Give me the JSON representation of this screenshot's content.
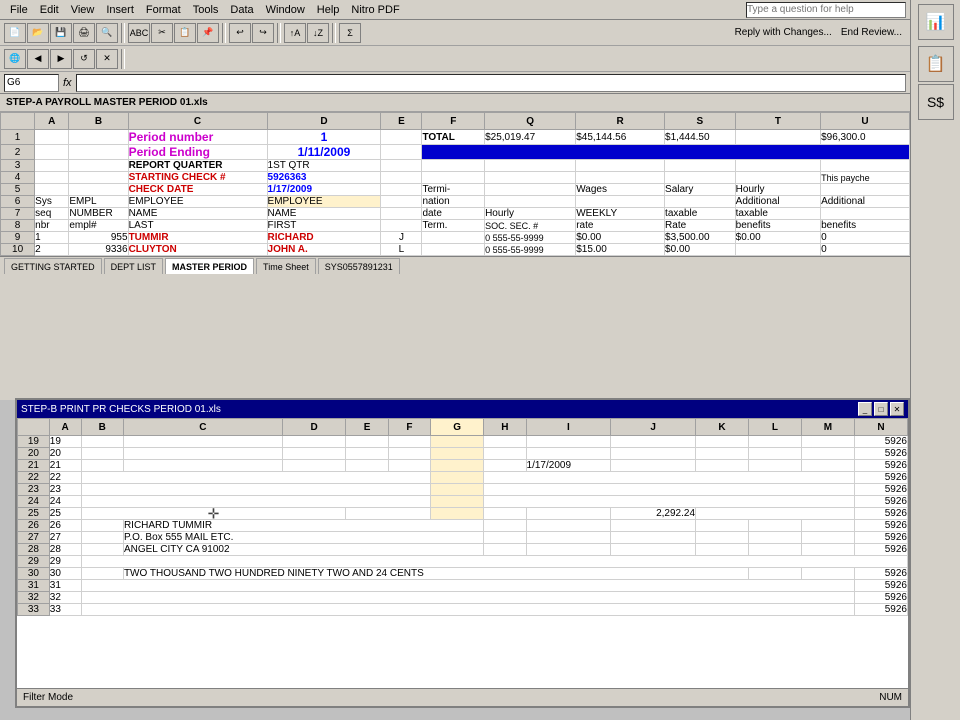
{
  "app": {
    "title": "STEP-A PAYROLL MASTER PERIOD 01.xls",
    "bottom_title": "STEP-B PRINT PR CHECKS PERIOD 01.xls",
    "question_placeholder": "Type a question for help"
  },
  "menu": {
    "items": [
      "File",
      "Edit",
      "View",
      "Insert",
      "Format",
      "Tools",
      "Data",
      "Window",
      "Help",
      "Nitro PDF"
    ]
  },
  "formula_bar": {
    "name_box": "G6",
    "formula": ""
  },
  "top_sheet": {
    "col_headers": [
      "",
      "A",
      "B",
      "C",
      "D",
      "E",
      "F",
      "Q",
      "R",
      "S",
      "T",
      "U"
    ],
    "rows": [
      {
        "num": "1",
        "a": "",
        "b": "",
        "c": "Period number",
        "d": "1",
        "e": "",
        "f": "TOTAL",
        "q": "$25,019.47",
        "r": "$45,144.56",
        "s": "$1,444.50",
        "t": "",
        "u": "$96,300.0"
      },
      {
        "num": "2",
        "a": "",
        "b": "",
        "c": "Period Ending",
        "d": "1/11/2009",
        "e": "",
        "f": "",
        "q": "",
        "r": "",
        "s": "",
        "t": "",
        "u": ""
      },
      {
        "num": "3",
        "a": "",
        "b": "",
        "c": "REPORT QUARTER",
        "d": "1ST QTR",
        "e": "",
        "f": "",
        "q": "",
        "r": "",
        "s": "",
        "t": "",
        "u": ""
      },
      {
        "num": "4",
        "a": "",
        "b": "",
        "c": "STARTING CHECK #",
        "d": "5926363",
        "e": "",
        "f": "",
        "q": "",
        "r": "",
        "s": "",
        "t": "",
        "u": "This payche"
      },
      {
        "num": "5",
        "a": "",
        "b": "",
        "c": "CHECK DATE",
        "d": "1/17/2009",
        "e": "",
        "f": "Termi-",
        "q": "",
        "r": "Wages",
        "s": "Salary",
        "t": "Hourly",
        "u": ""
      },
      {
        "num": "6",
        "a": "Sys",
        "b": "EMPL",
        "c": "EMPLOYEE",
        "d": "EMPLOYEE",
        "e": "",
        "f": "nation",
        "q": "",
        "r": "",
        "s": "",
        "t": "Additional",
        "u": "Additional"
      },
      {
        "num": "7",
        "a": "seq",
        "b": "NUMBER",
        "c": "NAME",
        "d": "NAME",
        "e": "",
        "f": "date",
        "q": "Hourly",
        "r": "WEEKLY",
        "s": "taxable",
        "t": "taxable",
        "u": ""
      },
      {
        "num": "8",
        "a": "nbr",
        "b": "empl#",
        "c": "LAST",
        "d": "FIRST",
        "e": "",
        "f": "Term.",
        "q": "SOC. SEC. #",
        "r": "rate",
        "s": "Rate",
        "t": "benefits",
        "u": "benefits"
      },
      {
        "num": "9",
        "a": "1",
        "b": "955",
        "c": "TUMMIR",
        "d": "RICHARD",
        "e": "J",
        "f": "",
        "q": "0 555-55-9999",
        "r": "$0.00",
        "s": "$3,500.00",
        "t": "$0.00",
        "u": "0"
      },
      {
        "num": "10",
        "a": "2",
        "b": "9336",
        "c": "CLUYTON",
        "d": "JOHN A.",
        "e": "L",
        "f": "",
        "q": "0 555-55-9999",
        "r": "$15.00",
        "s": "$0.00",
        "t": "",
        "u": "0"
      }
    ],
    "tabs": [
      "GETTING STARTED",
      "DEPT LIST",
      "MASTER PERIOD",
      "Time Sheet",
      "SYS0557891231"
    ]
  },
  "bottom_sheet": {
    "col_headers": [
      "",
      "A",
      "B",
      "C",
      "D",
      "E",
      "F",
      "G",
      "H",
      "I",
      "J",
      "K",
      "L",
      "M",
      "N"
    ],
    "rows": [
      {
        "num": "19",
        "a": "19",
        "b": "",
        "c": "",
        "d": "",
        "e": "",
        "f": "",
        "g": "",
        "h": "",
        "i": "",
        "j": "",
        "k": "",
        "l": "",
        "m": "",
        "n": "5926"
      },
      {
        "num": "20",
        "a": "20",
        "b": "",
        "c": "",
        "d": "",
        "e": "",
        "f": "",
        "g": "",
        "h": "",
        "i": "",
        "j": "",
        "k": "",
        "l": "",
        "m": "",
        "n": "5926"
      },
      {
        "num": "21",
        "a": "21",
        "b": "",
        "c": "",
        "d": "",
        "e": "",
        "f": "",
        "g": "",
        "h": "",
        "i": "1/17/2009",
        "j": "",
        "k": "",
        "l": "",
        "m": "",
        "n": "5926"
      },
      {
        "num": "22",
        "a": "22",
        "b": "",
        "c": "",
        "d": "",
        "e": "",
        "f": "",
        "g": "",
        "h": "",
        "i": "",
        "j": "",
        "k": "",
        "l": "",
        "m": "",
        "n": "5926"
      },
      {
        "num": "23",
        "a": "23",
        "b": "",
        "c": "",
        "d": "",
        "e": "",
        "f": "",
        "g": "",
        "h": "",
        "i": "",
        "j": "",
        "k": "",
        "l": "",
        "m": "",
        "n": "5926"
      },
      {
        "num": "24",
        "a": "24",
        "b": "",
        "c": "",
        "d": "",
        "e": "",
        "f": "",
        "g": "",
        "h": "",
        "i": "",
        "j": "",
        "k": "",
        "l": "",
        "m": "",
        "n": "5926"
      },
      {
        "num": "25",
        "a": "25",
        "b": "",
        "c": "",
        "d": "",
        "e": "",
        "f": "",
        "g": "",
        "h": "",
        "i": "",
        "j": "2,292.24",
        "k": "",
        "l": "",
        "m": "",
        "n": "5926",
        "cursor": true
      },
      {
        "num": "26",
        "a": "26",
        "b": "",
        "c": "RICHARD  TUMMIR",
        "d": "",
        "e": "",
        "f": "",
        "g": "",
        "h": "",
        "i": "",
        "j": "",
        "k": "",
        "l": "",
        "m": "",
        "n": "5926"
      },
      {
        "num": "27",
        "a": "27",
        "b": "",
        "c": "P.O. Box 555   MAIL ETC.",
        "d": "",
        "e": "",
        "f": "",
        "g": "",
        "h": "",
        "i": "",
        "j": "",
        "k": "",
        "l": "",
        "m": "",
        "n": "5926"
      },
      {
        "num": "28",
        "a": "28",
        "b": "",
        "c": "ANGEL CITY   CA 91002",
        "d": "",
        "e": "",
        "f": "",
        "g": "",
        "h": "",
        "i": "",
        "j": "",
        "k": "",
        "l": "",
        "m": "",
        "n": "5926"
      },
      {
        "num": "29",
        "a": "29",
        "b": "",
        "c": "",
        "d": "",
        "e": "",
        "f": "",
        "g": "",
        "h": "",
        "i": "",
        "j": "",
        "k": "",
        "l": "",
        "m": "",
        "n": ""
      },
      {
        "num": "30",
        "a": "30",
        "b": "",
        "c": "TWO THOUSAND TWO HUNDRED NINETY TWO AND  24 CENTS",
        "d": "",
        "e": "",
        "f": "",
        "g": "",
        "h": "",
        "i": "",
        "j": "",
        "k": "",
        "l": "",
        "m": "",
        "n": "5926"
      },
      {
        "num": "31",
        "a": "31",
        "b": "",
        "c": "",
        "d": "",
        "e": "",
        "f": "",
        "g": "",
        "h": "",
        "i": "",
        "j": "",
        "k": "",
        "l": "",
        "m": "",
        "n": "5926"
      },
      {
        "num": "32",
        "a": "32",
        "b": "",
        "c": "",
        "d": "",
        "e": "",
        "f": "",
        "g": "",
        "h": "",
        "i": "",
        "j": "",
        "k": "",
        "l": "",
        "m": "",
        "n": "5926"
      },
      {
        "num": "33",
        "a": "33",
        "b": "",
        "c": "",
        "d": "",
        "e": "",
        "f": "",
        "g": "",
        "h": "",
        "i": "",
        "j": "",
        "k": "",
        "l": "",
        "m": "",
        "n": "5926"
      }
    ]
  },
  "status": {
    "left": "Filter Mode",
    "right": "NUM"
  }
}
